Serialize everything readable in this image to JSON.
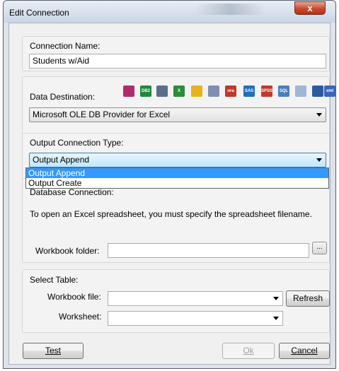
{
  "window": {
    "title": "Edit Connection",
    "close_glyph": "x"
  },
  "connection_name": {
    "label": "Connection Name:",
    "value": "Students w/Aid"
  },
  "data_destination": {
    "label": "Data Destination:",
    "selected": "Microsoft OLE DB Provider for Excel",
    "icons": [
      {
        "name": "access-icon",
        "glyph": "",
        "color": "#b22a6b"
      },
      {
        "name": "db2-icon",
        "glyph": "DB2",
        "color": "#1e8a3c"
      },
      {
        "name": "sql-server-icon",
        "glyph": "",
        "color": "#5a6f8a"
      },
      {
        "name": "excel-icon",
        "glyph": "X",
        "color": "#2e8b3a"
      },
      {
        "name": "jet-icon",
        "glyph": "",
        "color": "#e7b21c"
      },
      {
        "name": "odbc-icon",
        "glyph": "",
        "color": "#7e8fb0"
      },
      {
        "name": "oracle-icon",
        "glyph": "ora",
        "color": "#c0392b"
      },
      {
        "name": "sas-icon",
        "glyph": "SAS",
        "color": "#1f6fbf"
      },
      {
        "name": "spss-icon",
        "glyph": "SPSS",
        "color": "#c0392b"
      },
      {
        "name": "sql-icon",
        "glyph": "SQL",
        "color": "#4a7dbf"
      },
      {
        "name": "text-file-icon",
        "glyph": "",
        "color": "#9fb6d6"
      },
      {
        "name": "dbase-icon",
        "glyph": "",
        "color": "#2c5aa0"
      },
      {
        "name": "xml-icon",
        "glyph": "xml",
        "color": "#3a66b8"
      }
    ]
  },
  "output_type": {
    "label": "Output Connection Type:",
    "selected": "Output Append",
    "options": [
      "Output Append",
      "Output Create"
    ]
  },
  "db_connection": {
    "label": "Database Connection:",
    "note": "To open an Excel spreadsheet, you must specify the spreadsheet filename.",
    "folder_label": "Workbook folder:",
    "folder_value": "",
    "browse_label": "..."
  },
  "select_table": {
    "label": "Select Table:",
    "file_label": "Workbook file:",
    "file_value": "",
    "refresh_label": "Refresh",
    "sheet_label": "Worksheet:",
    "sheet_value": ""
  },
  "footer": {
    "test_label": "Test",
    "ok_label": "Ok",
    "cancel_label": "Cancel"
  }
}
